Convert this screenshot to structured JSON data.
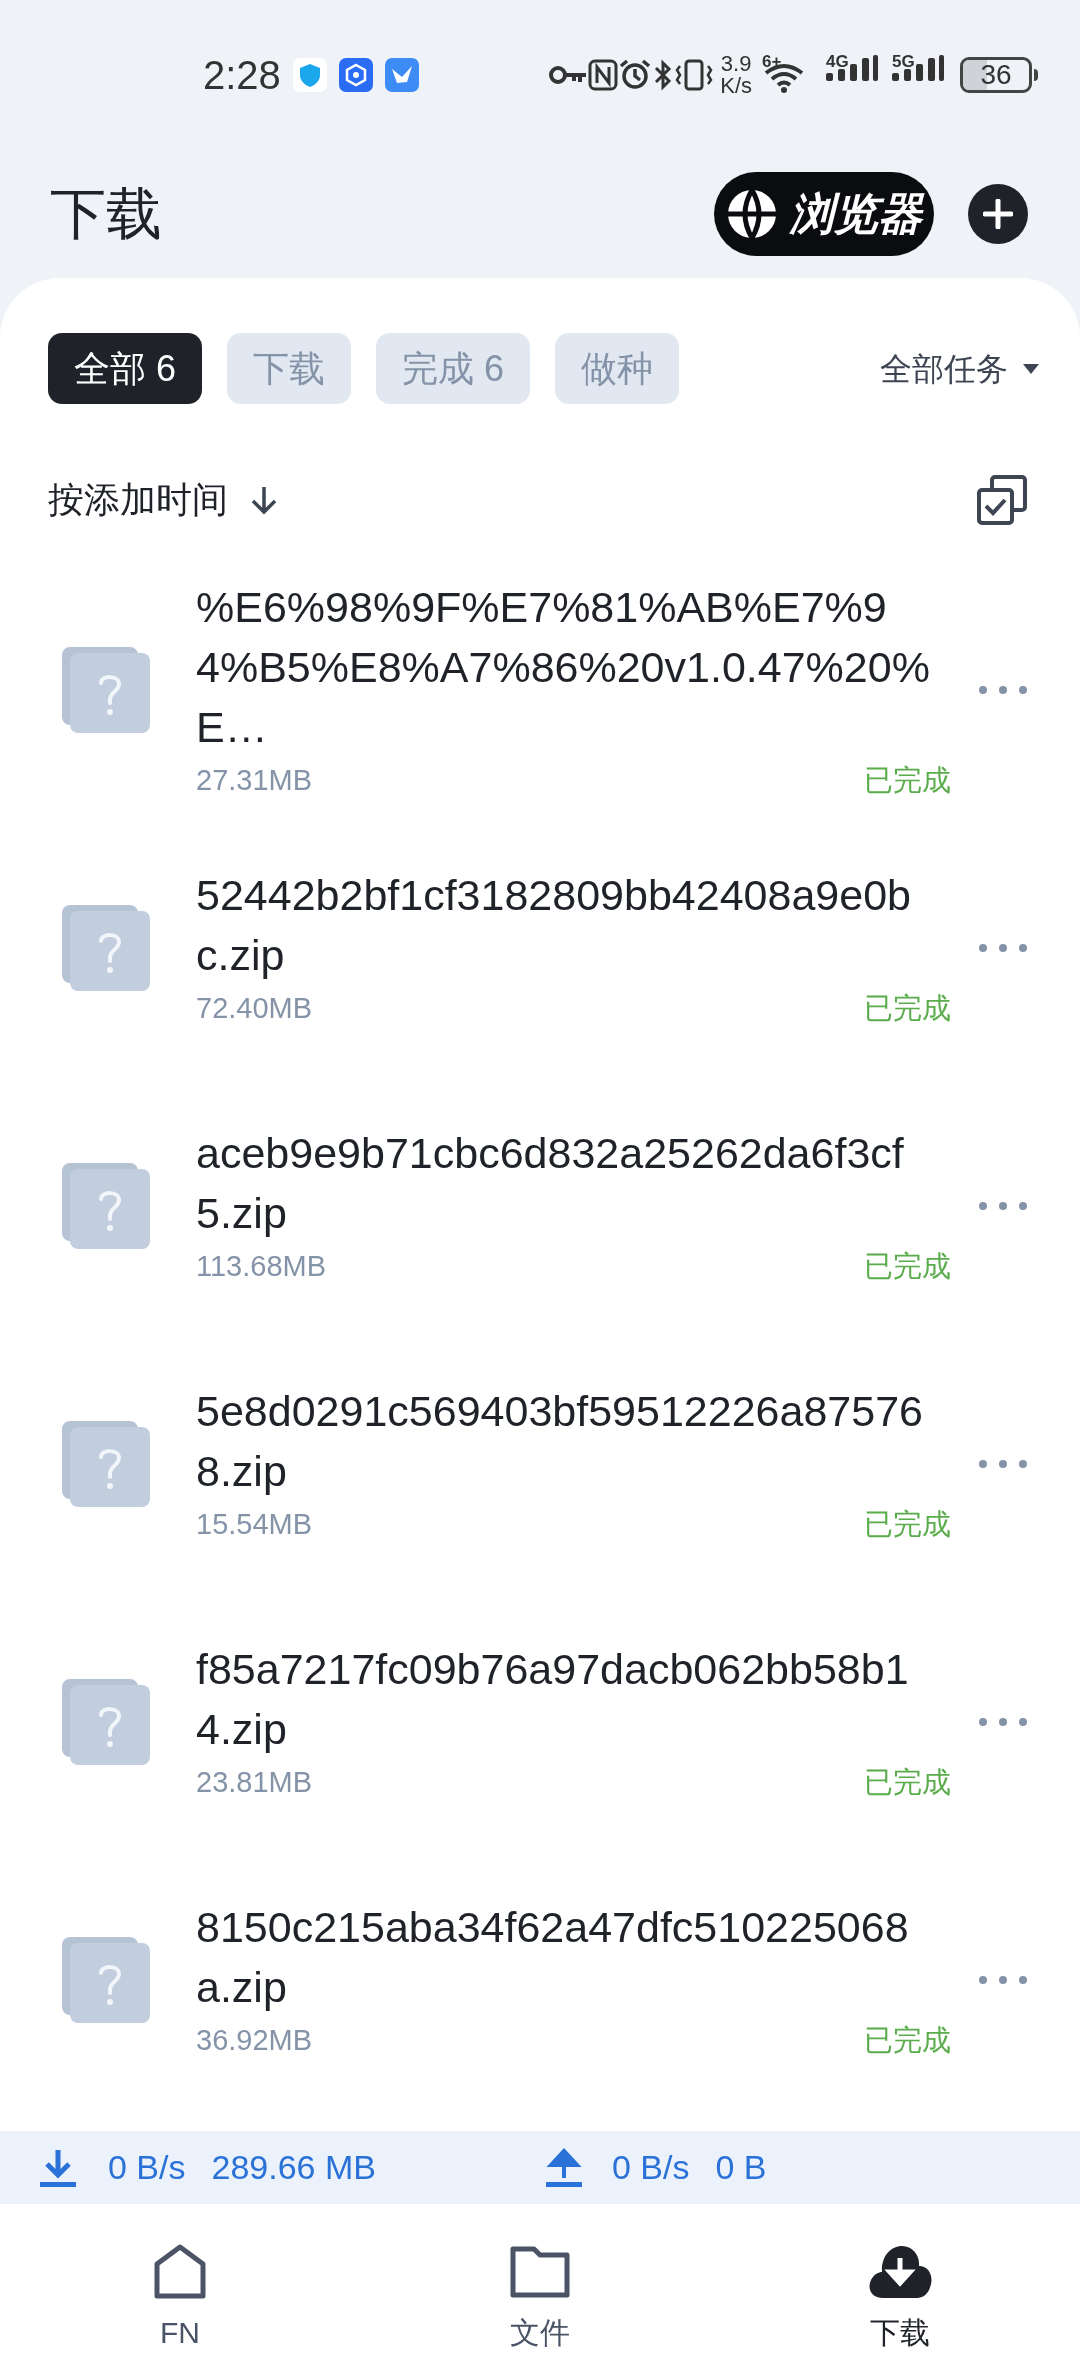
{
  "status_bar": {
    "time": "2:28",
    "speed_value": "3.9",
    "speed_unit": "K/s",
    "wifi_badge": "6+",
    "sim1": "4G",
    "sim2": "5G",
    "battery": "36"
  },
  "header": {
    "title": "下载",
    "browser_button": "浏览器"
  },
  "tabs": [
    {
      "label": "全部 6",
      "selected": true
    },
    {
      "label": "下载",
      "selected": false
    },
    {
      "label": "完成 6",
      "selected": false
    },
    {
      "label": "做种",
      "selected": false
    }
  ],
  "task_filter": "全部任务",
  "sort": {
    "label": "按添加时间"
  },
  "downloads": [
    {
      "name": "%E6%98%9F%E7%81%AB%E7%94%B5%E8%A7%86%20v1.0.47%20%E…",
      "size": "27.31MB",
      "status": "已完成"
    },
    {
      "name": "52442b2bf1cf3182809bb42408a9e0bc.zip",
      "size": "72.40MB",
      "status": "已完成"
    },
    {
      "name": "aceb9e9b71cbc6d832a25262da6f3cf5.zip",
      "size": "113.68MB",
      "status": "已完成"
    },
    {
      "name": "5e8d0291c569403bf59512226a875768.zip",
      "size": "15.54MB",
      "status": "已完成"
    },
    {
      "name": "f85a7217fc09b76a97dacb062bb58b14.zip",
      "size": "23.81MB",
      "status": "已完成"
    },
    {
      "name": "8150c215aba34f62a47dfc510225068a.zip",
      "size": "36.92MB",
      "status": "已完成"
    }
  ],
  "transfer": {
    "download_speed": "0 B/s",
    "download_total": "289.66 MB",
    "upload_speed": "0 B/s",
    "upload_total": "0 B"
  },
  "nav": [
    {
      "label": "FN",
      "kind": "home",
      "selected": false
    },
    {
      "label": "文件",
      "kind": "folder",
      "selected": false
    },
    {
      "label": "下载",
      "kind": "download",
      "selected": true
    }
  ]
}
